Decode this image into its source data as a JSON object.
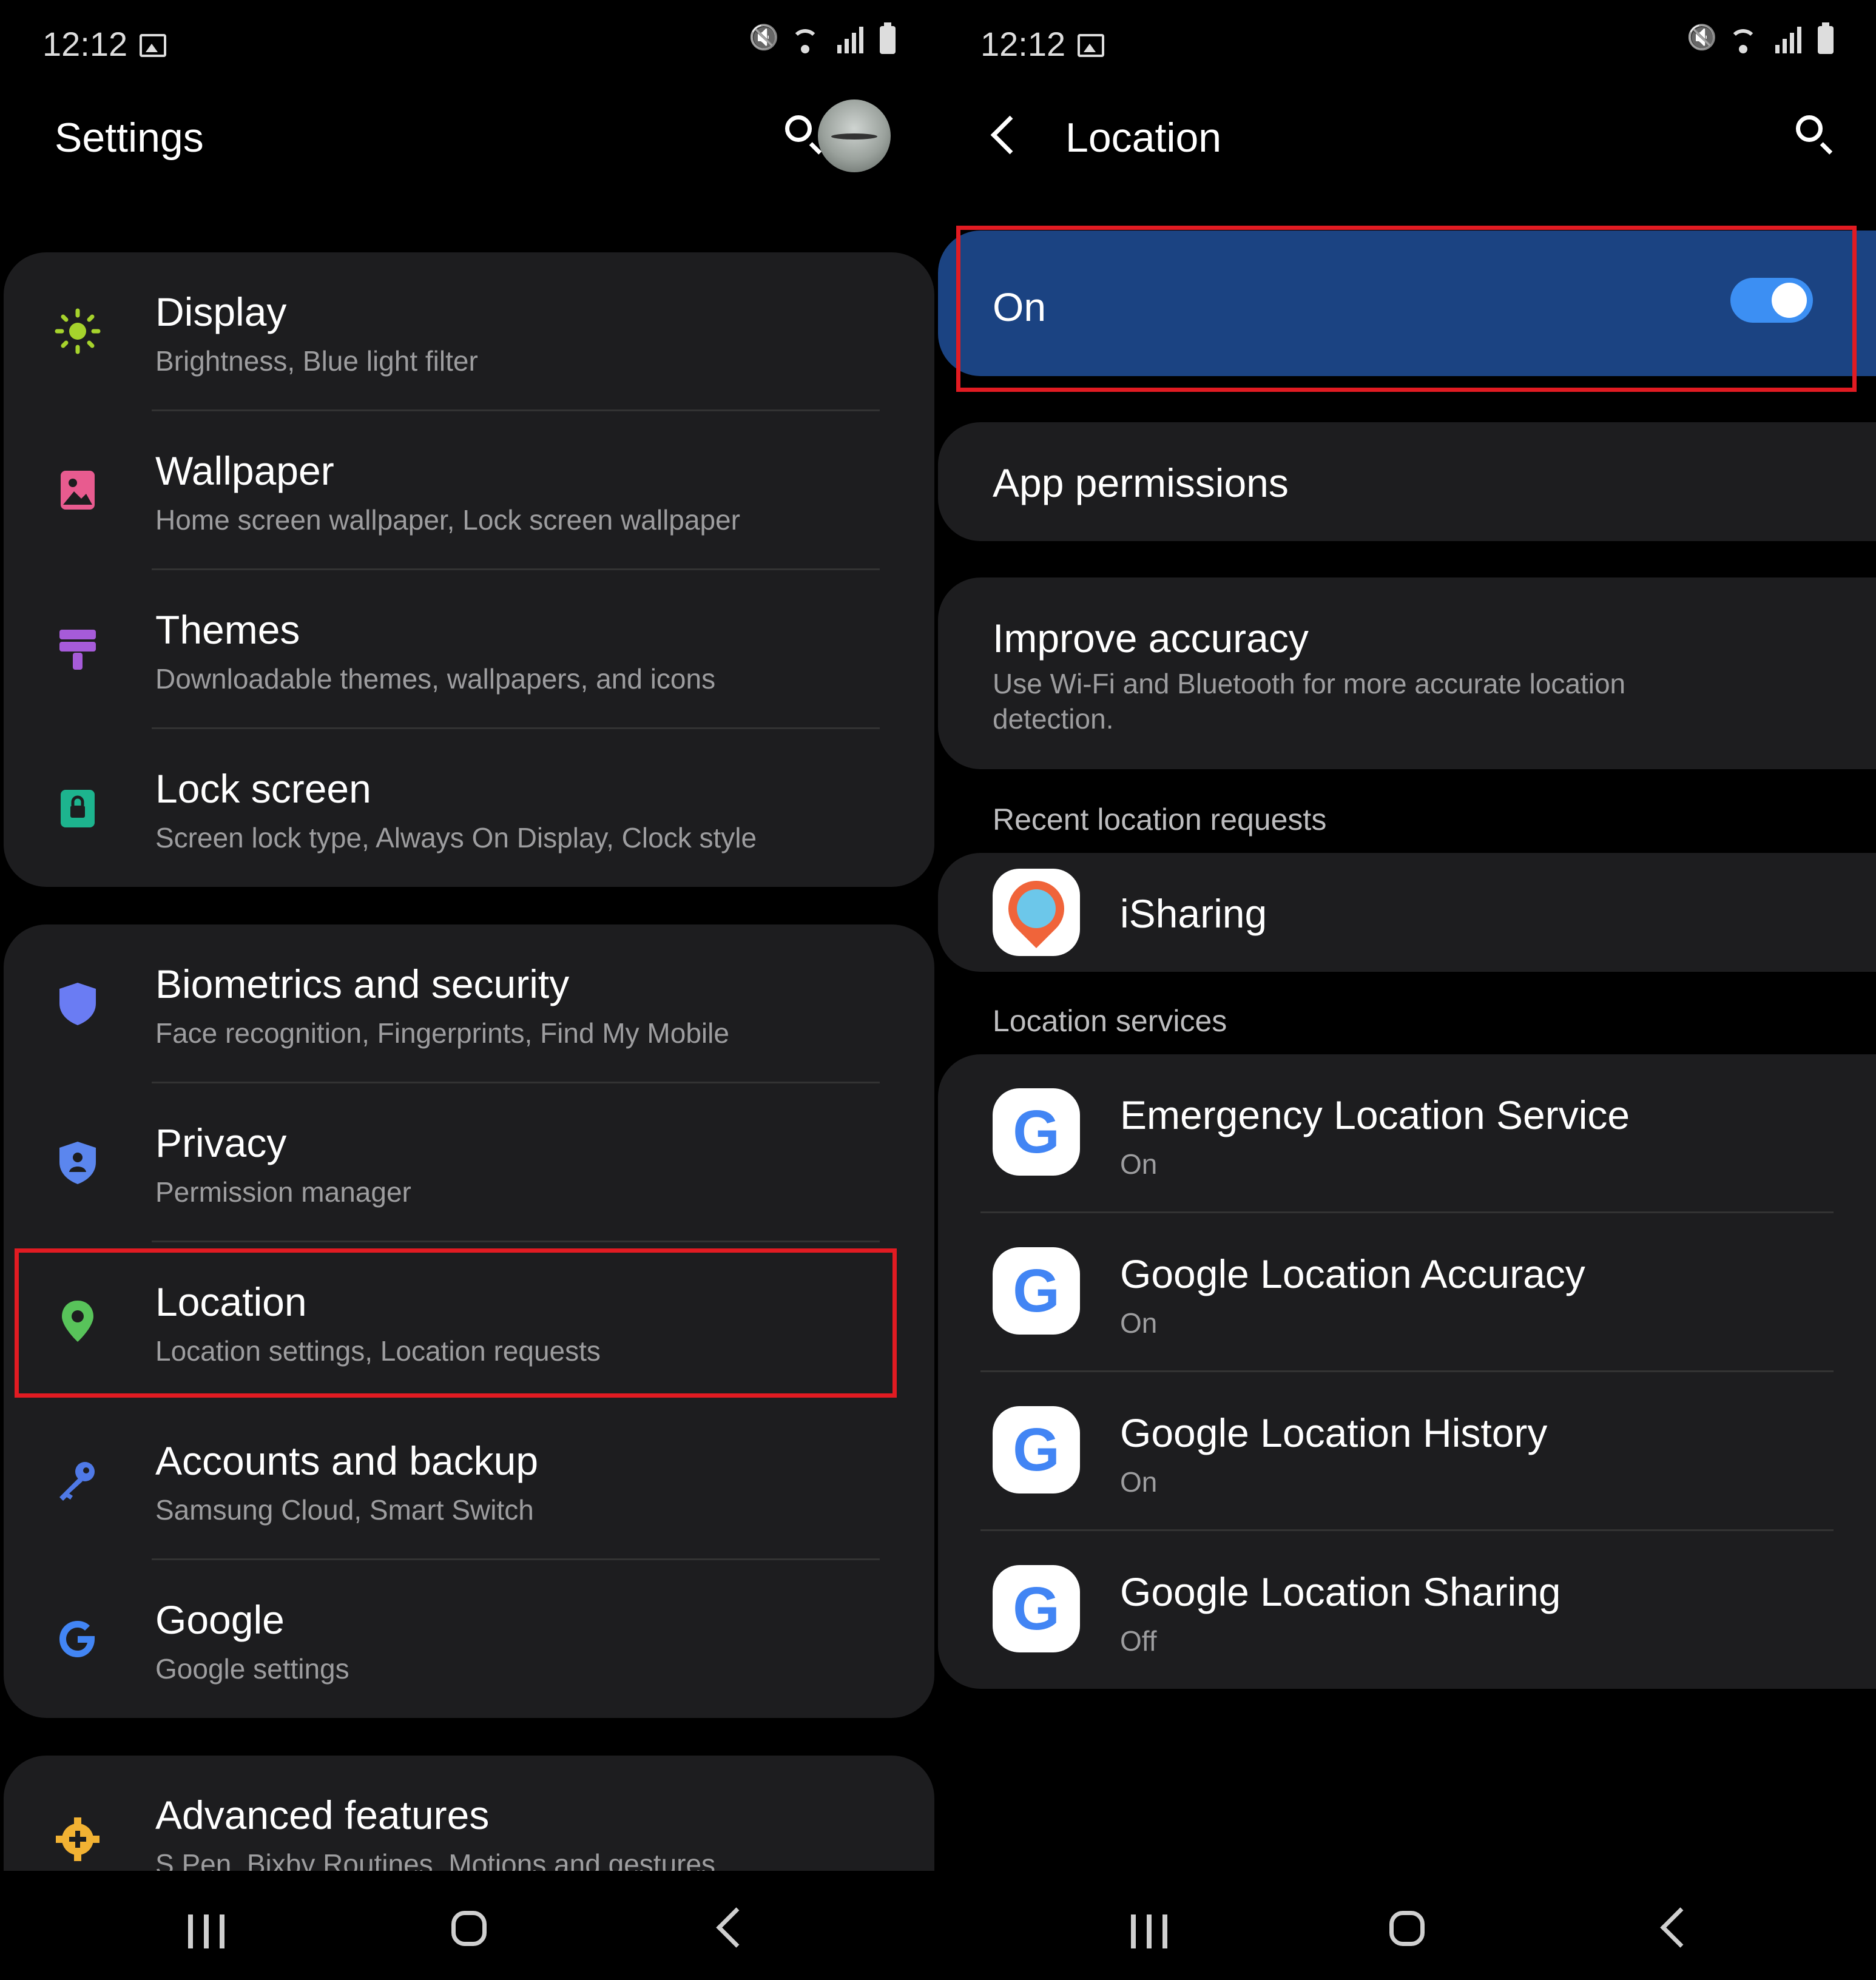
{
  "status": {
    "time": "12:12"
  },
  "left": {
    "title": "Settings",
    "groups": [
      [
        {
          "title": "Display",
          "subtitle": "Brightness, Blue light filter",
          "icon": "sun-icon",
          "color": "#a6d32c"
        },
        {
          "title": "Wallpaper",
          "subtitle": "Home screen wallpaper, Lock screen wallpaper",
          "icon": "image-icon",
          "color": "#e85b8f"
        },
        {
          "title": "Themes",
          "subtitle": "Downloadable themes, wallpapers, and icons",
          "icon": "brush-icon",
          "color": "#a65bd9"
        },
        {
          "title": "Lock screen",
          "subtitle": "Screen lock type, Always On Display, Clock style",
          "icon": "lock-icon",
          "color": "#1db48e"
        }
      ],
      [
        {
          "title": "Biometrics and security",
          "subtitle": "Face recognition, Fingerprints, Find My Mobile",
          "icon": "shield-icon",
          "color": "#6a7cf3"
        },
        {
          "title": "Privacy",
          "subtitle": "Permission manager",
          "icon": "privacy-shield-icon",
          "color": "#5b86ee"
        },
        {
          "title": "Location",
          "subtitle": "Location settings, Location requests",
          "icon": "location-pin-icon",
          "color": "#58c35a"
        },
        {
          "title": "Accounts and backup",
          "subtitle": "Samsung Cloud, Smart Switch",
          "icon": "key-icon",
          "color": "#4f79e6"
        },
        {
          "title": "Google",
          "subtitle": "Google settings",
          "icon": "google-g-icon",
          "color": "#4285F4"
        }
      ],
      [
        {
          "title": "Advanced features",
          "subtitle": "S Pen, Bixby Routines, Motions and gestures",
          "icon": "gear-plus-icon",
          "color": "#f2b233"
        }
      ]
    ]
  },
  "right": {
    "title": "Location",
    "toggle_label": "On",
    "toggle_on": true,
    "app_permissions": "App permissions",
    "improve": {
      "title": "Improve accuracy",
      "subtitle_line1": "Use Wi-Fi and Bluetooth for more accurate location",
      "subtitle_line2": "detection."
    },
    "recent_header": "Recent location requests",
    "recent_app": "iSharing",
    "services_header": "Location services",
    "services": [
      {
        "title": "Emergency Location Service",
        "status": "On"
      },
      {
        "title": "Google Location Accuracy",
        "status": "On"
      },
      {
        "title": "Google Location History",
        "status": "On"
      },
      {
        "title": "Google Location Sharing",
        "status": "Off"
      }
    ]
  }
}
